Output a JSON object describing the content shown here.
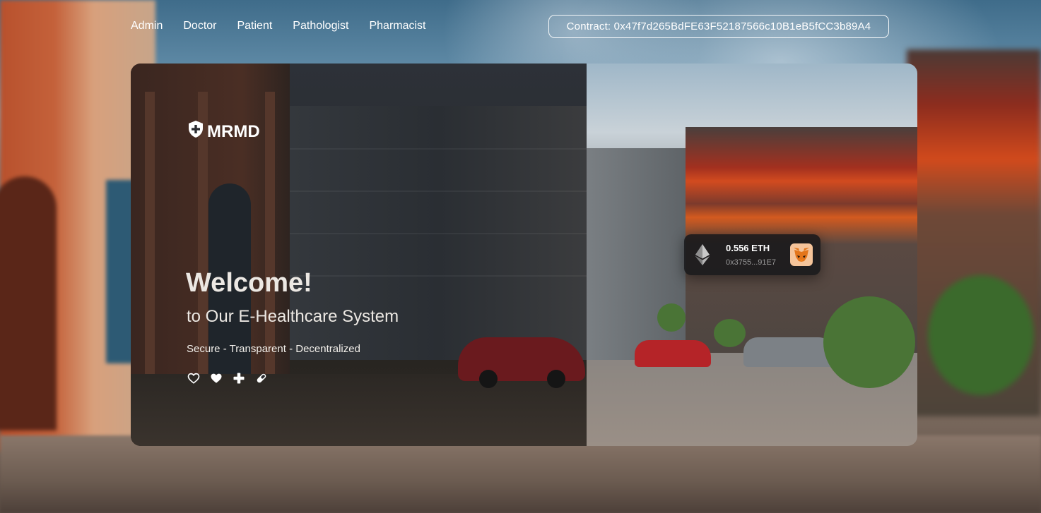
{
  "nav": {
    "items": [
      {
        "label": "Admin"
      },
      {
        "label": "Doctor"
      },
      {
        "label": "Patient"
      },
      {
        "label": "Pathologist"
      },
      {
        "label": "Pharmacist"
      }
    ],
    "contract": "Contract: 0x47f7d265BdFE63F52187566c10B1eB5fCC3b89A4"
  },
  "hero": {
    "brand": "MRMD",
    "brand_icon": "shield-plus-icon",
    "welcome": "Welcome!",
    "subtitle": "to Our E-Healthcare System",
    "tagline": "Secure - Transparent - Decentralized",
    "icons": [
      "heart-outline-icon",
      "heart-filled-icon",
      "plus-icon",
      "pill-icon"
    ]
  },
  "wallet": {
    "amount": "0.556 ETH",
    "address": "0x3755...91E7",
    "currency_icon": "ethereum-icon",
    "provider_icon": "metamask-fox-icon"
  },
  "colors": {
    "text": "#ffffff",
    "panel_dark": "#2a2b2f",
    "wallet_bg": "#18181a"
  }
}
